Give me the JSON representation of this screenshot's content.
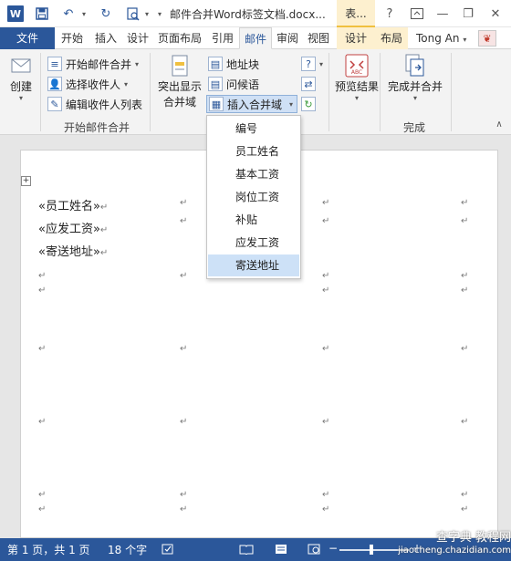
{
  "titlebar": {
    "app_icon": "W",
    "document_title": "邮件合并Word标签文档.docx...",
    "context_tab_title": "表...",
    "qat_icons": [
      "save-icon",
      "undo-icon",
      "redo-icon",
      "print-preview-icon",
      "customize-qat-icon"
    ],
    "window_controls": [
      "help-icon",
      "ribbon-display-icon",
      "minimize-icon",
      "close-icon"
    ]
  },
  "tabs": [
    {
      "label": "文件"
    },
    {
      "label": "开始"
    },
    {
      "label": "插入"
    },
    {
      "label": "设计"
    },
    {
      "label": "页面布局"
    },
    {
      "label": "引用"
    },
    {
      "label": "邮件"
    },
    {
      "label": "审阅"
    },
    {
      "label": "视图"
    },
    {
      "label": "设计"
    },
    {
      "label": "布局"
    }
  ],
  "user": {
    "name": "Tong An",
    "caret": "▾"
  },
  "ribbon": {
    "create": {
      "label": "创建"
    },
    "start_group": {
      "start_merge": "开始邮件合并",
      "select_recipients": "选择收件人",
      "edit_recipients": "编辑收件人列表",
      "group_label": "开始邮件合并"
    },
    "fields_group": {
      "highlight": "突出显示",
      "highlight2": "合并域",
      "address_block": "地址块",
      "greeting": "问候语",
      "insert_field": "插入合并域"
    },
    "preview": {
      "label": "预览结果",
      "icon_text": "ABC"
    },
    "finish": {
      "label": "完成并合并",
      "group_label": "完成"
    }
  },
  "document": {
    "move_handle": "+",
    "fields": [
      "«员工姓名»",
      "«应发工资»",
      "«寄送地址»"
    ],
    "para_mark": "↵"
  },
  "dropdown": {
    "items": [
      "编号",
      "员工姓名",
      "基本工资",
      "岗位工资",
      "补贴",
      "应发工资",
      "寄送地址"
    ],
    "selected": "寄送地址"
  },
  "status": {
    "page": "第 1 页，共 1 页",
    "words": "18 个字",
    "zoom_percent": 100
  },
  "watermark": {
    "line1": "查字典 教程网",
    "line2": "jiaocheng.chazidian.com"
  }
}
